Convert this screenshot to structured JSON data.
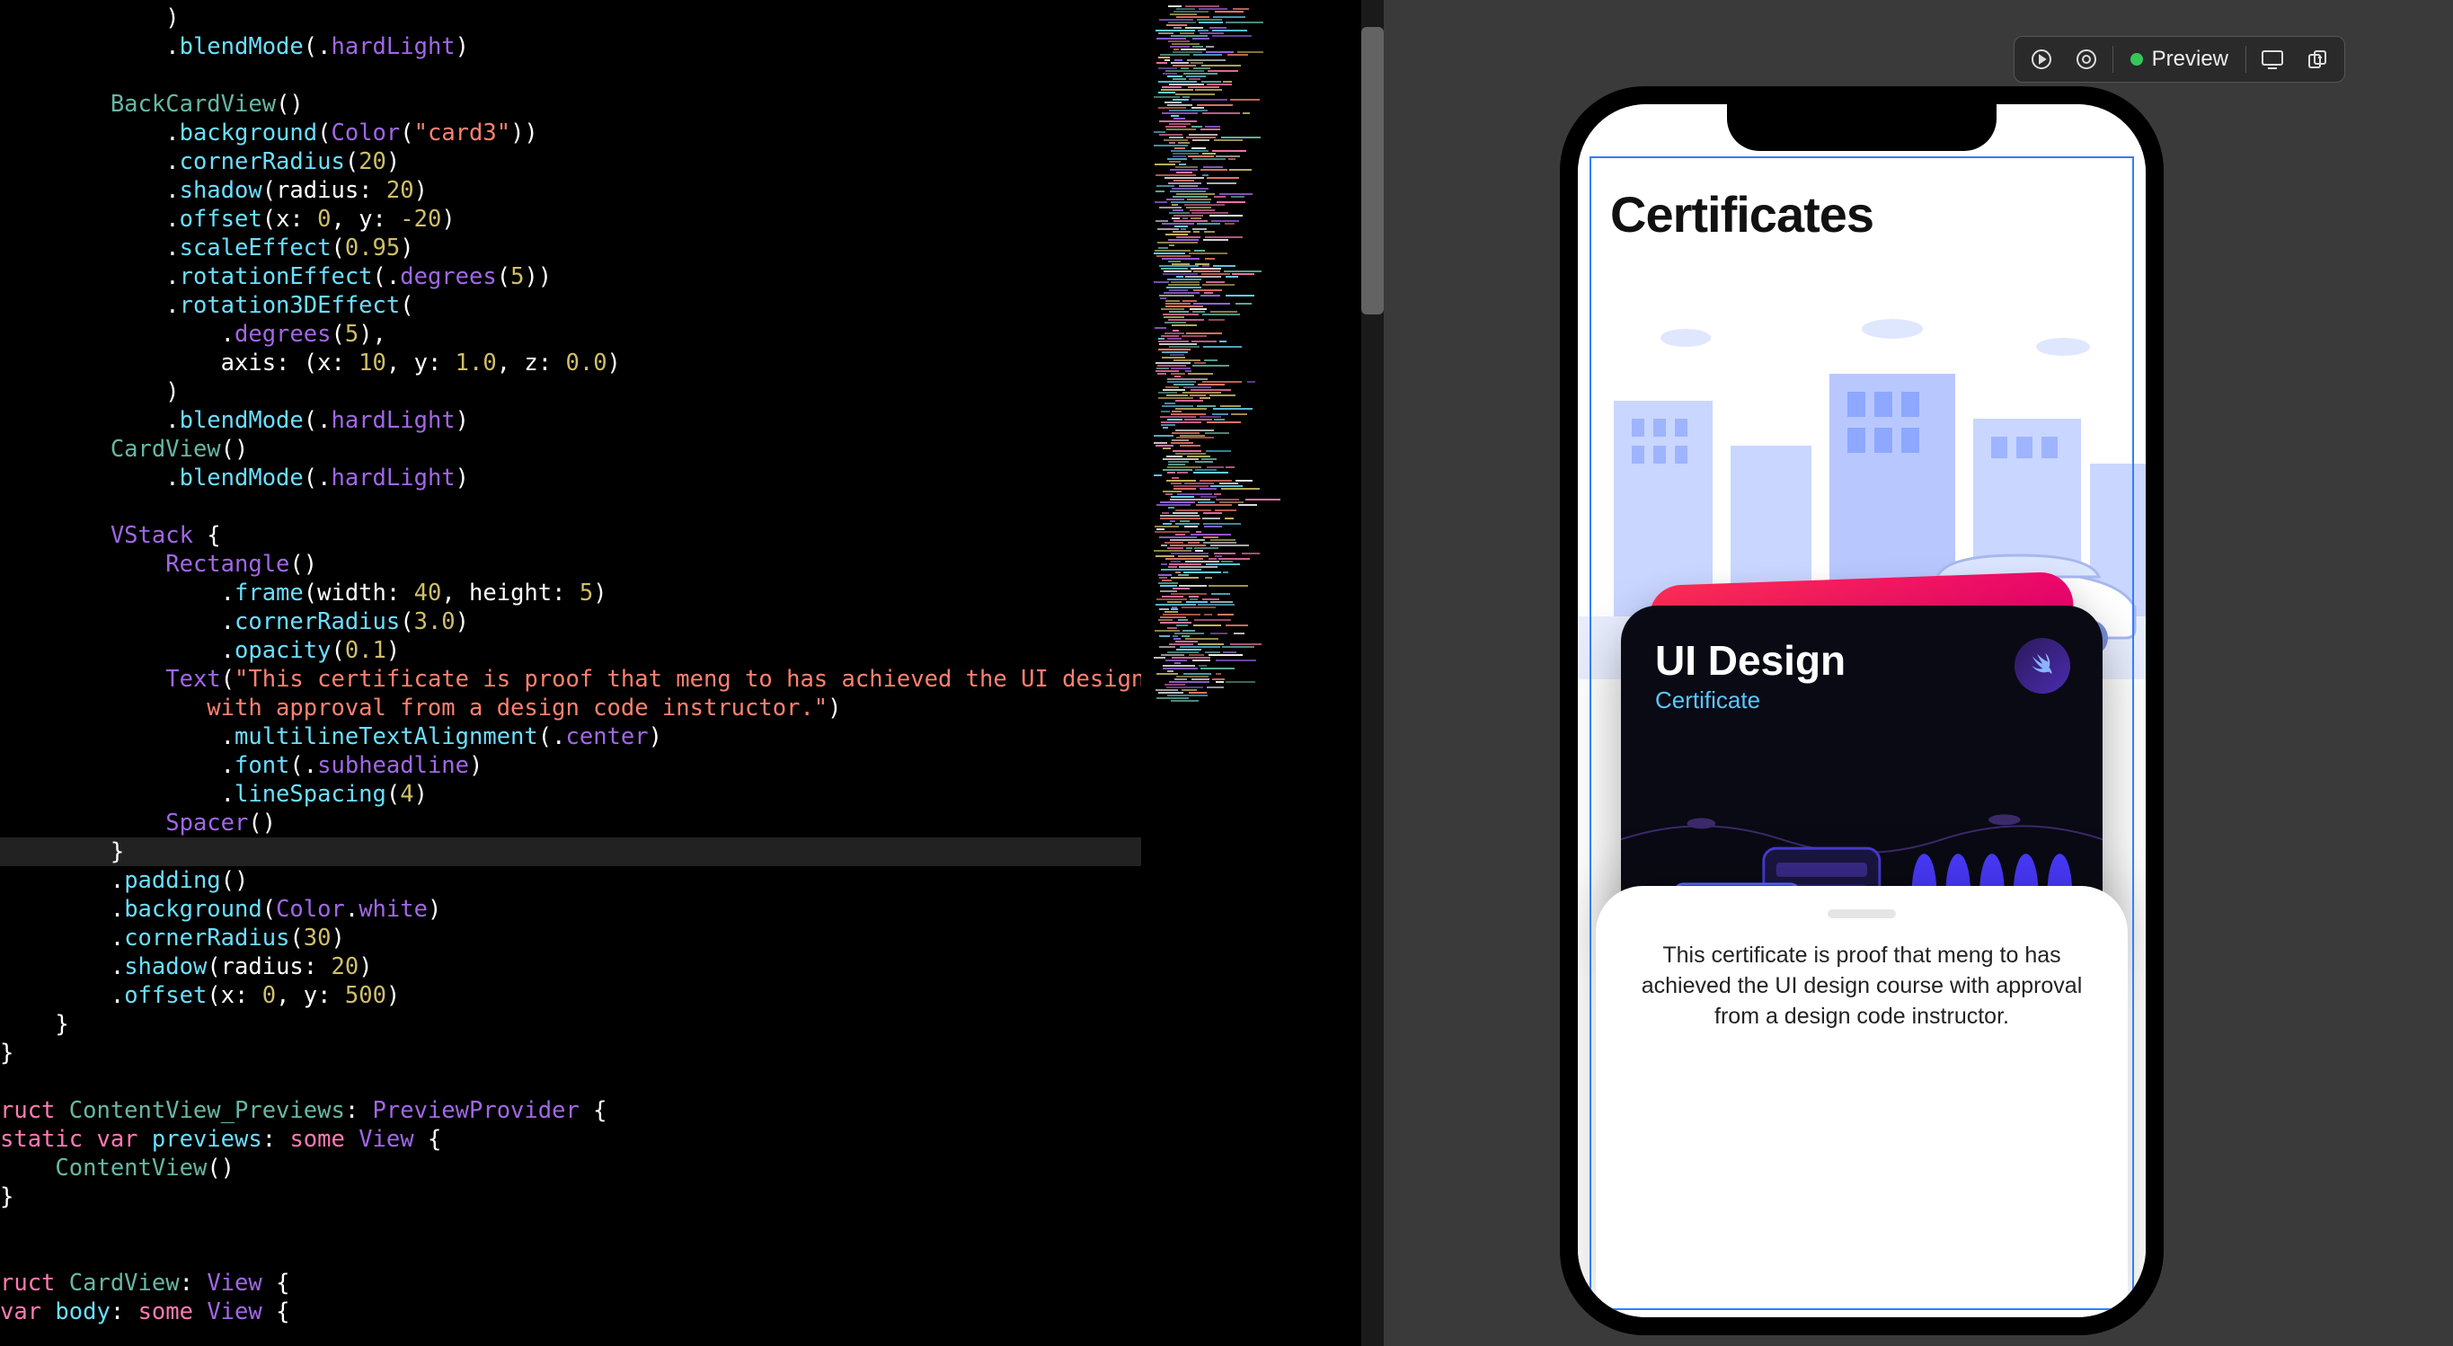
{
  "toolbar": {
    "preview_label": "Preview"
  },
  "app": {
    "page_title": "Certificates",
    "card_title": "UI Design",
    "card_subtitle": "Certificate",
    "sheet_text": "This certificate is proof that meng to has achieved the UI design course with approval from a design code instructor."
  },
  "code": {
    "lines": [
      [
        [
          12,
          "pl",
          ")"
        ]
      ],
      [
        [
          12,
          "pl",
          "."
        ],
        [
          0,
          "ty",
          "blendMode"
        ],
        [
          0,
          "pl",
          "(."
        ],
        [
          0,
          "id",
          "hardLight"
        ],
        [
          0,
          "pl",
          ")"
        ]
      ],
      [],
      [
        [
          8,
          "fn",
          "BackCardView"
        ],
        [
          0,
          "pl",
          "()"
        ]
      ],
      [
        [
          12,
          "pl",
          "."
        ],
        [
          0,
          "ty",
          "background"
        ],
        [
          0,
          "pl",
          "("
        ],
        [
          0,
          "id",
          "Color"
        ],
        [
          0,
          "pl",
          "("
        ],
        [
          0,
          "str",
          "\"card3\""
        ],
        [
          0,
          "pl",
          "))"
        ]
      ],
      [
        [
          12,
          "pl",
          "."
        ],
        [
          0,
          "ty",
          "cornerRadius"
        ],
        [
          0,
          "pl",
          "("
        ],
        [
          0,
          "num",
          "20"
        ],
        [
          0,
          "pl",
          ")"
        ]
      ],
      [
        [
          12,
          "pl",
          "."
        ],
        [
          0,
          "ty",
          "shadow"
        ],
        [
          0,
          "pl",
          "(radius: "
        ],
        [
          0,
          "num",
          "20"
        ],
        [
          0,
          "pl",
          ")"
        ]
      ],
      [
        [
          12,
          "pl",
          "."
        ],
        [
          0,
          "ty",
          "offset"
        ],
        [
          0,
          "pl",
          "(x: "
        ],
        [
          0,
          "num",
          "0"
        ],
        [
          0,
          "pl",
          ", y: "
        ],
        [
          0,
          "num",
          "-20"
        ],
        [
          0,
          "pl",
          ")"
        ]
      ],
      [
        [
          12,
          "pl",
          "."
        ],
        [
          0,
          "ty",
          "scaleEffect"
        ],
        [
          0,
          "pl",
          "("
        ],
        [
          0,
          "num",
          "0.95"
        ],
        [
          0,
          "pl",
          ")"
        ]
      ],
      [
        [
          12,
          "pl",
          "."
        ],
        [
          0,
          "ty",
          "rotationEffect"
        ],
        [
          0,
          "pl",
          "(."
        ],
        [
          0,
          "id",
          "degrees"
        ],
        [
          0,
          "pl",
          "("
        ],
        [
          0,
          "num",
          "5"
        ],
        [
          0,
          "pl",
          "))"
        ]
      ],
      [
        [
          12,
          "pl",
          "."
        ],
        [
          0,
          "ty",
          "rotation3DEffect"
        ],
        [
          0,
          "pl",
          "("
        ]
      ],
      [
        [
          16,
          "pl",
          "."
        ],
        [
          0,
          "id",
          "degrees"
        ],
        [
          0,
          "pl",
          "("
        ],
        [
          0,
          "num",
          "5"
        ],
        [
          0,
          "pl",
          "),"
        ]
      ],
      [
        [
          16,
          "pl",
          "axis: (x: "
        ],
        [
          0,
          "num",
          "10"
        ],
        [
          0,
          "pl",
          ", y: "
        ],
        [
          0,
          "num",
          "1.0"
        ],
        [
          0,
          "pl",
          ", z: "
        ],
        [
          0,
          "num",
          "0.0"
        ],
        [
          0,
          "pl",
          ")"
        ]
      ],
      [
        [
          12,
          "pl",
          ")"
        ]
      ],
      [
        [
          12,
          "pl",
          "."
        ],
        [
          0,
          "ty",
          "blendMode"
        ],
        [
          0,
          "pl",
          "(."
        ],
        [
          0,
          "id",
          "hardLight"
        ],
        [
          0,
          "pl",
          ")"
        ]
      ],
      [
        [
          8,
          "fn",
          "CardView"
        ],
        [
          0,
          "pl",
          "()"
        ]
      ],
      [
        [
          12,
          "pl",
          "."
        ],
        [
          0,
          "ty",
          "blendMode"
        ],
        [
          0,
          "pl",
          "(."
        ],
        [
          0,
          "id",
          "hardLight"
        ],
        [
          0,
          "pl",
          ")"
        ]
      ],
      [],
      [
        [
          8,
          "id",
          "VStack"
        ],
        [
          0,
          "pl",
          " {"
        ]
      ],
      [
        [
          12,
          "id",
          "Rectangle"
        ],
        [
          0,
          "pl",
          "()"
        ]
      ],
      [
        [
          16,
          "pl",
          "."
        ],
        [
          0,
          "ty",
          "frame"
        ],
        [
          0,
          "pl",
          "(width: "
        ],
        [
          0,
          "num",
          "40"
        ],
        [
          0,
          "pl",
          ", height: "
        ],
        [
          0,
          "num",
          "5"
        ],
        [
          0,
          "pl",
          ")"
        ]
      ],
      [
        [
          16,
          "pl",
          "."
        ],
        [
          0,
          "ty",
          "cornerRadius"
        ],
        [
          0,
          "pl",
          "("
        ],
        [
          0,
          "num",
          "3.0"
        ],
        [
          0,
          "pl",
          ")"
        ]
      ],
      [
        [
          16,
          "pl",
          "."
        ],
        [
          0,
          "ty",
          "opacity"
        ],
        [
          0,
          "pl",
          "("
        ],
        [
          0,
          "num",
          "0.1"
        ],
        [
          0,
          "pl",
          ")"
        ]
      ],
      [
        [
          12,
          "id",
          "Text"
        ],
        [
          0,
          "pl",
          "("
        ],
        [
          0,
          "str",
          "\"This certificate is proof that meng to has achieved the UI design course"
        ]
      ],
      [
        [
          15,
          "str",
          "with approval from a design code instructor.\""
        ],
        [
          0,
          "pl",
          ")"
        ]
      ],
      [
        [
          16,
          "pl",
          "."
        ],
        [
          0,
          "ty",
          "multilineTextAlignment"
        ],
        [
          0,
          "pl",
          "(."
        ],
        [
          0,
          "id",
          "center"
        ],
        [
          0,
          "pl",
          ")"
        ]
      ],
      [
        [
          16,
          "pl",
          "."
        ],
        [
          0,
          "ty",
          "font"
        ],
        [
          0,
          "pl",
          "(."
        ],
        [
          0,
          "id",
          "subheadline"
        ],
        [
          0,
          "pl",
          ")"
        ]
      ],
      [
        [
          16,
          "pl",
          "."
        ],
        [
          0,
          "ty",
          "lineSpacing"
        ],
        [
          0,
          "pl",
          "("
        ],
        [
          0,
          "num",
          "4"
        ],
        [
          0,
          "pl",
          ")"
        ]
      ],
      [
        [
          12,
          "id",
          "Spacer"
        ],
        [
          0,
          "pl",
          "()"
        ]
      ],
      [
        [
          8,
          "pl",
          "}"
        ]
      ],
      [
        [
          8,
          "pl",
          "."
        ],
        [
          0,
          "ty",
          "padding"
        ],
        [
          0,
          "pl",
          "()"
        ]
      ],
      [
        [
          8,
          "pl",
          "."
        ],
        [
          0,
          "ty",
          "background"
        ],
        [
          0,
          "pl",
          "("
        ],
        [
          0,
          "id",
          "Color"
        ],
        [
          0,
          "pl",
          "."
        ],
        [
          0,
          "id",
          "white"
        ],
        [
          0,
          "pl",
          ")"
        ]
      ],
      [
        [
          8,
          "pl",
          "."
        ],
        [
          0,
          "ty",
          "cornerRadius"
        ],
        [
          0,
          "pl",
          "("
        ],
        [
          0,
          "num",
          "30"
        ],
        [
          0,
          "pl",
          ")"
        ]
      ],
      [
        [
          8,
          "pl",
          "."
        ],
        [
          0,
          "ty",
          "shadow"
        ],
        [
          0,
          "pl",
          "(radius: "
        ],
        [
          0,
          "num",
          "20"
        ],
        [
          0,
          "pl",
          ")"
        ]
      ],
      [
        [
          8,
          "pl",
          "."
        ],
        [
          0,
          "ty",
          "offset"
        ],
        [
          0,
          "pl",
          "(x: "
        ],
        [
          0,
          "num",
          "0"
        ],
        [
          0,
          "pl",
          ", y: "
        ],
        [
          0,
          "num",
          "500"
        ],
        [
          0,
          "pl",
          ")"
        ]
      ],
      [
        [
          4,
          "pl",
          "}"
        ]
      ],
      [
        [
          0,
          "pl",
          "}"
        ]
      ],
      [],
      [
        [
          -4,
          "kw",
          "ruct "
        ],
        [
          0,
          "fn",
          "ContentView_Previews"
        ],
        [
          0,
          "pl",
          ": "
        ],
        [
          0,
          "id",
          "PreviewProvider"
        ],
        [
          0,
          "pl",
          " {"
        ]
      ],
      [
        [
          0,
          "kw",
          "static var "
        ],
        [
          0,
          "ty",
          "previews"
        ],
        [
          0,
          "pl",
          ": "
        ],
        [
          0,
          "kw",
          "some "
        ],
        [
          0,
          "id",
          "View"
        ],
        [
          0,
          "pl",
          " {"
        ]
      ],
      [
        [
          4,
          "fn",
          "ContentView"
        ],
        [
          0,
          "pl",
          "()"
        ]
      ],
      [
        [
          0,
          "pl",
          "}"
        ]
      ],
      [],
      [],
      [
        [
          -4,
          "kw",
          "ruct "
        ],
        [
          0,
          "fn",
          "CardView"
        ],
        [
          0,
          "pl",
          ": "
        ],
        [
          0,
          "id",
          "View"
        ],
        [
          0,
          "pl",
          " {"
        ]
      ],
      [
        [
          0,
          "kw",
          "var "
        ],
        [
          0,
          "ty",
          "body"
        ],
        [
          0,
          "pl",
          ": "
        ],
        [
          0,
          "kw",
          "some "
        ],
        [
          0,
          "id",
          "View"
        ],
        [
          0,
          "pl",
          " {"
        ]
      ]
    ],
    "highlight_line": 29
  },
  "colors": {
    "accent": "#2f7fff",
    "status_green": "#34c759",
    "card3": "#ff2d55"
  }
}
